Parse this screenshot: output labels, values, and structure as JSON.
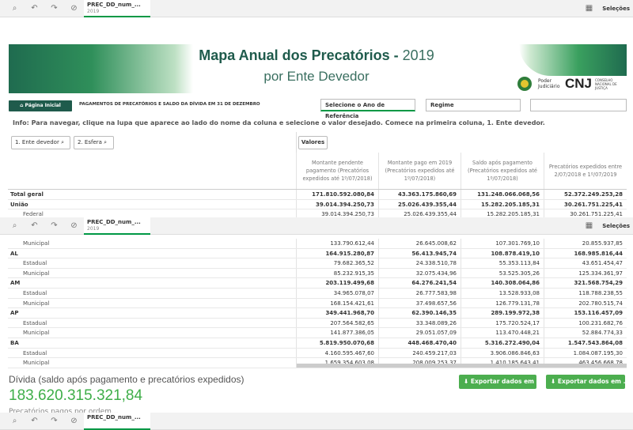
{
  "toolbar": {
    "tab_title": "PREC_DD_num_...",
    "tab_sub": "2019",
    "selections": "Seleções"
  },
  "header": {
    "title_main": "Mapa Anual dos Precatórios -",
    "title_year": "2019",
    "title_sub": "por Ente Devedor",
    "pj_label": "Poder Judiciário",
    "cnj_label": "CNJ",
    "cnj_full": "CONSELHO NACIONAL DE JUSTIÇA"
  },
  "nav": {
    "home_button": "Página Inicial",
    "subtitle": "PAGAMENTOS DE PRECATÓRIOS E SALDO DA DÍVIDA EM 31 DE DEZEMBRO",
    "filter_year": "Selecione o Ano de Referência",
    "filter_regime": "Regime"
  },
  "info": "Info: Para navegar, clique na lupa que aparece ao lado do nome da coluna e selecione o valor desejado. Comece na primeira coluna, 1. Ente devedor.",
  "table": {
    "dim1": "1. Ente devedor",
    "dim2": "2. Esfera",
    "valores": "Valores",
    "headers": [
      "Montante pendente pagamento (Precatórios expedidos até 1º/07/2018)",
      "Montante pago em 2019 (Precatórios expedidos até 1º/07/2018)",
      "Saldo após pagamento (Precatórios expedidos até 1º/07/2018)",
      "Precatórios expedidos entre 2/07/2018 e 1º/07/2019"
    ],
    "top_rows": [
      {
        "label": "Total geral",
        "bold": true,
        "v": [
          "171.810.592.080,84",
          "43.363.175.860,69",
          "131.248.066.068,56",
          "52.372.249.253,28"
        ]
      },
      {
        "label": "União",
        "bold": true,
        "v": [
          "39.014.394.250,73",
          "25.026.439.355,44",
          "15.282.205.185,31",
          "30.261.751.225,41"
        ]
      },
      {
        "label": "Federal",
        "bold": false,
        "v": [
          "39.014.394.250,73",
          "25.026.439.355,44",
          "15.282.205.185,31",
          "30.261.751.225,41"
        ]
      }
    ],
    "bottom_rows": [
      {
        "label": "Municipal",
        "bold": false,
        "v": [
          "133.790.612,44",
          "26.645.008,62",
          "107.301.769,10",
          "20.855.937,85"
        ]
      },
      {
        "label": "AL",
        "bold": true,
        "v": [
          "164.915.280,87",
          "56.413.945,74",
          "108.878.419,10",
          "168.985.816,44"
        ]
      },
      {
        "label": "Estadual",
        "bold": false,
        "v": [
          "79.682.365,52",
          "24.338.510,78",
          "55.353.113,84",
          "43.651.454,47"
        ]
      },
      {
        "label": "Municipal",
        "bold": false,
        "v": [
          "85.232.915,35",
          "32.075.434,96",
          "53.525.305,26",
          "125.334.361,97"
        ]
      },
      {
        "label": "AM",
        "bold": true,
        "v": [
          "203.119.499,68",
          "64.276.241,54",
          "140.308.064,86",
          "321.568.754,29"
        ]
      },
      {
        "label": "Estadual",
        "bold": false,
        "v": [
          "34.965.078,07",
          "26.777.583,98",
          "13.528.933,08",
          "118.788.238,55"
        ]
      },
      {
        "label": "Municipal",
        "bold": false,
        "v": [
          "168.154.421,61",
          "37.498.657,56",
          "126.779.131,78",
          "202.780.515,74"
        ]
      },
      {
        "label": "AP",
        "bold": true,
        "v": [
          "349.441.968,70",
          "62.390.146,35",
          "289.199.972,38",
          "153.116.457,09"
        ]
      },
      {
        "label": "Estadual",
        "bold": false,
        "v": [
          "207.564.582,65",
          "33.348.089,26",
          "175.720.524,17",
          "100.231.682,76"
        ]
      },
      {
        "label": "Municipal",
        "bold": false,
        "v": [
          "141.877.386,05",
          "29.051.057,09",
          "113.470.448,21",
          "52.884.774,33"
        ]
      },
      {
        "label": "BA",
        "bold": true,
        "v": [
          "5.819.950.070,68",
          "448.468.470,40",
          "5.316.272.490,04",
          "1.547.543.864,08"
        ]
      },
      {
        "label": "Estadual",
        "bold": false,
        "v": [
          "4.160.595.467,60",
          "240.459.217,03",
          "3.906.086.846,63",
          "1.084.087.195,30"
        ]
      },
      {
        "label": "Municipal",
        "bold": false,
        "v": [
          "1.659.354.603,08",
          "208.009.253,37",
          "1.410.185.643,41",
          "463.456.668,78"
        ]
      }
    ]
  },
  "kpi": {
    "label": "Dívida (saldo após pagamento e precatórios expedidos)",
    "value": "183.620.315.321,84"
  },
  "exports": {
    "xls": "Exportar dados em .xls",
    "csv": "Exportar dados em .csv"
  },
  "footer_cut": "Precatórios pagos por ordem..."
}
